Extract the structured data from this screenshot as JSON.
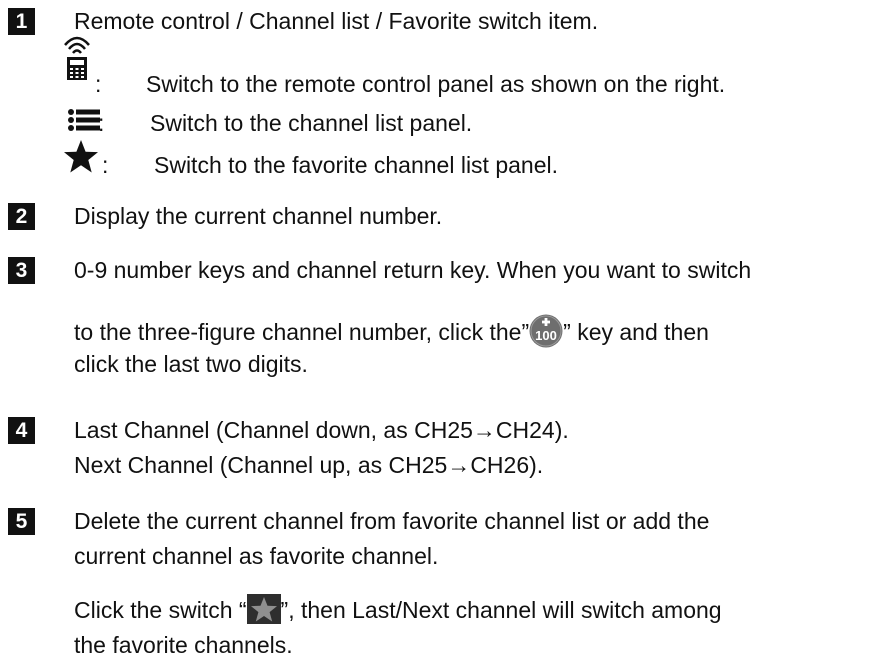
{
  "items": [
    {
      "number": "1",
      "title": "Remote control / Channel list / Favorite switch item.",
      "sub": [
        {
          "icon": "remote-control-icon",
          "sep": ":",
          "text": "Switch to the remote control panel as shown on the right."
        },
        {
          "icon": "list-icon",
          "sep": ":",
          "text": "Switch to the channel list panel."
        },
        {
          "icon": "star-icon",
          "sep": ":",
          "text": "Switch to the favorite channel list panel."
        }
      ]
    },
    {
      "number": "2",
      "text": "Display the current channel number."
    },
    {
      "number": "3",
      "line1": "0-9 number keys and channel return key. When you want to switch",
      "line2_before": "to the three-figure channel number, click the”",
      "key_icon_label": "100",
      "line2_after": "” key and then",
      "line3": "click the last two digits."
    },
    {
      "number": "4",
      "line1": "Last Channel (Channel down, as CH25→CH24).",
      "line2": "Next Channel (Channel up, as CH25→CH26)."
    },
    {
      "number": "5",
      "line1": "Delete the current channel from favorite channel list or add the",
      "line2": "current channel as favorite channel.",
      "line3_before": "Click the switch “",
      "line3_after": "”, then Last/Next channel will switch among",
      "line4": "the favorite channels."
    }
  ],
  "colors": {
    "text": "#111111",
    "badge_bg": "#111111",
    "badge_text": "#ffffff",
    "star_key_bg": "#2e2e2e",
    "hundred_key_bg": "#6e6e6e"
  }
}
